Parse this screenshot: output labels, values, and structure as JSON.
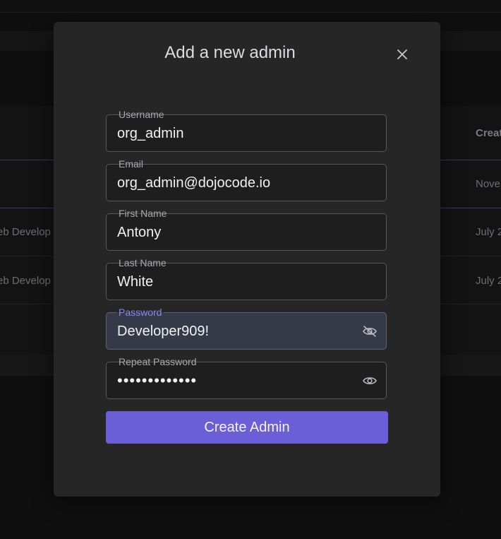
{
  "background": {
    "table_header": "Creat",
    "rows": [
      {
        "role": "",
        "date": "Nove"
      },
      {
        "role": "eb Develop",
        "date": "July 2"
      },
      {
        "role": "eb Develop",
        "date": "July 2"
      }
    ]
  },
  "modal": {
    "title": "Add a new admin",
    "fields": {
      "username": {
        "label": "Username",
        "value": "org_admin"
      },
      "email": {
        "label": "Email",
        "value": "org_admin@dojocode.io"
      },
      "first_name": {
        "label": "First Name",
        "value": "Antony"
      },
      "last_name": {
        "label": "Last Name",
        "value": "White"
      },
      "password": {
        "label": "Password",
        "value": "Developer909!"
      },
      "repeat_password": {
        "label": "Repeat Password",
        "value": "•••••••••••••"
      }
    },
    "submit_label": "Create Admin"
  },
  "colors": {
    "accent": "#6a5fd6",
    "focused_label": "#8e86ec",
    "modal_bg": "#262627"
  },
  "icons": {
    "close": "close-icon",
    "password_toggle": "eye-off-icon",
    "repeat_password_toggle": "eye-icon"
  }
}
